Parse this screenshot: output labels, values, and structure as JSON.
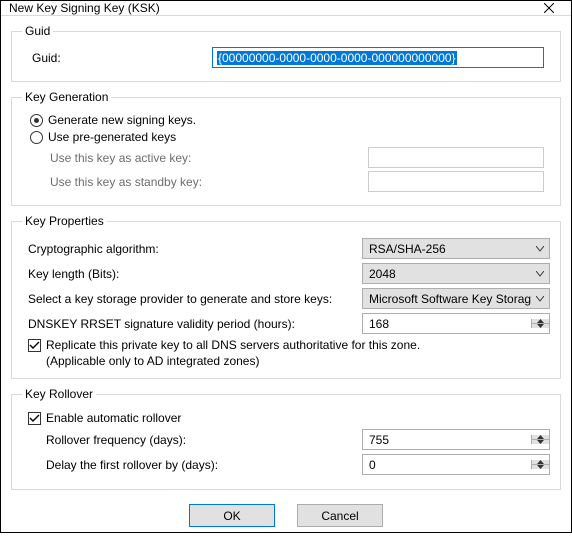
{
  "window": {
    "title": "New Key Signing Key (KSK)"
  },
  "guid_group": {
    "legend": "Guid",
    "label": "Guid:",
    "value": "{00000000-0000-0000-0000-000000000000}"
  },
  "keygen_group": {
    "legend": "Key Generation",
    "opt_generate": "Generate new signing keys.",
    "opt_pre": "Use pre-generated keys",
    "active_label": "Use this key as active key:",
    "standby_label": "Use this key as standby key:"
  },
  "keyprops_group": {
    "legend": "Key Properties",
    "algo_label": "Cryptographic algorithm:",
    "algo_value": "RSA/SHA-256",
    "keylen_label": "Key length (Bits):",
    "keylen_value": "2048",
    "ksp_label": "Select a key storage provider to generate and store keys:",
    "ksp_value": "Microsoft Software Key Storage Prov",
    "validity_label": "DNSKEY RRSET signature validity period (hours):",
    "validity_value": "168",
    "replicate_label": "Replicate this private key to all DNS servers authoritative for this zone.",
    "replicate_note": "(Applicable only to AD integrated zones)"
  },
  "rollover_group": {
    "legend": "Key Rollover",
    "enable_label": "Enable automatic rollover",
    "freq_label": "Rollover frequency (days):",
    "freq_value": "755",
    "delay_label": "Delay the first rollover by (days):",
    "delay_value": "0"
  },
  "buttons": {
    "ok": "OK",
    "cancel": "Cancel"
  }
}
